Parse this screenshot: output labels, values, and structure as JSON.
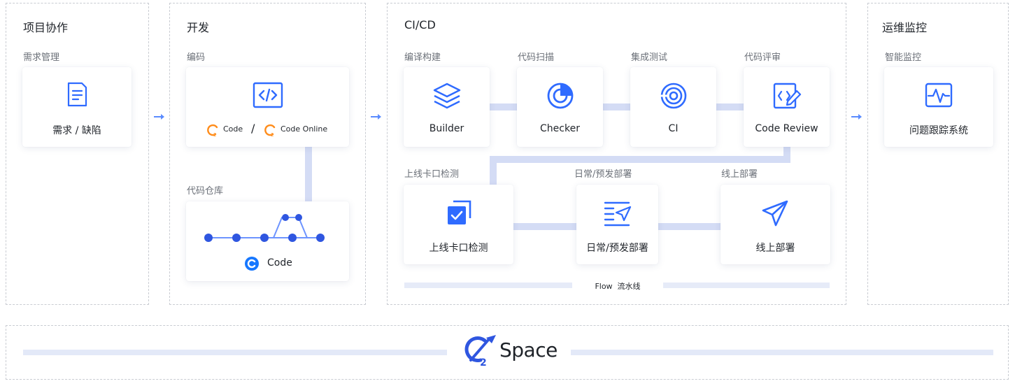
{
  "stages": {
    "collab": {
      "title": "项目协作",
      "sub": "需求管理",
      "card": "需求 / 缺陷"
    },
    "dev": {
      "title": "开发",
      "coding": {
        "sub": "编码",
        "code": "Code",
        "slash": "/",
        "code_online": "Code Online"
      },
      "repo": {
        "sub": "代码仓库",
        "card": "Code"
      }
    },
    "cicd": {
      "title": "CI/CD",
      "build": {
        "sub": "编译构建",
        "card": "Builder"
      },
      "scan": {
        "sub": "代码扫描",
        "card": "Checker"
      },
      "test": {
        "sub": "集成测试",
        "card": "CI"
      },
      "review": {
        "sub": "代码评审",
        "card": "Code Review"
      },
      "gate": {
        "sub": "上线卡口检测",
        "card": "上线卡口检测"
      },
      "daily": {
        "sub": "日常/预发部署",
        "card": "日常/预发部署"
      },
      "online": {
        "sub": "线上部署",
        "card": "线上部署"
      },
      "flow": "Flow  流水线"
    },
    "ops": {
      "title": "运维监控",
      "sub": "智能监控",
      "card": "问题跟踪系统"
    }
  },
  "brand": {
    "name": "Space"
  },
  "colors": {
    "accent": "#2f6bff",
    "orange": "#ff8c1a",
    "connector": "#d4dcf5"
  },
  "icons": [
    "document-icon",
    "code-icon",
    "commit-graph-icon",
    "layers-icon",
    "scan-icon",
    "target-icon",
    "code-review-icon",
    "check-copy-icon",
    "deploy-list-icon",
    "send-icon",
    "heartbeat-icon",
    "arrow-right-icon"
  ]
}
